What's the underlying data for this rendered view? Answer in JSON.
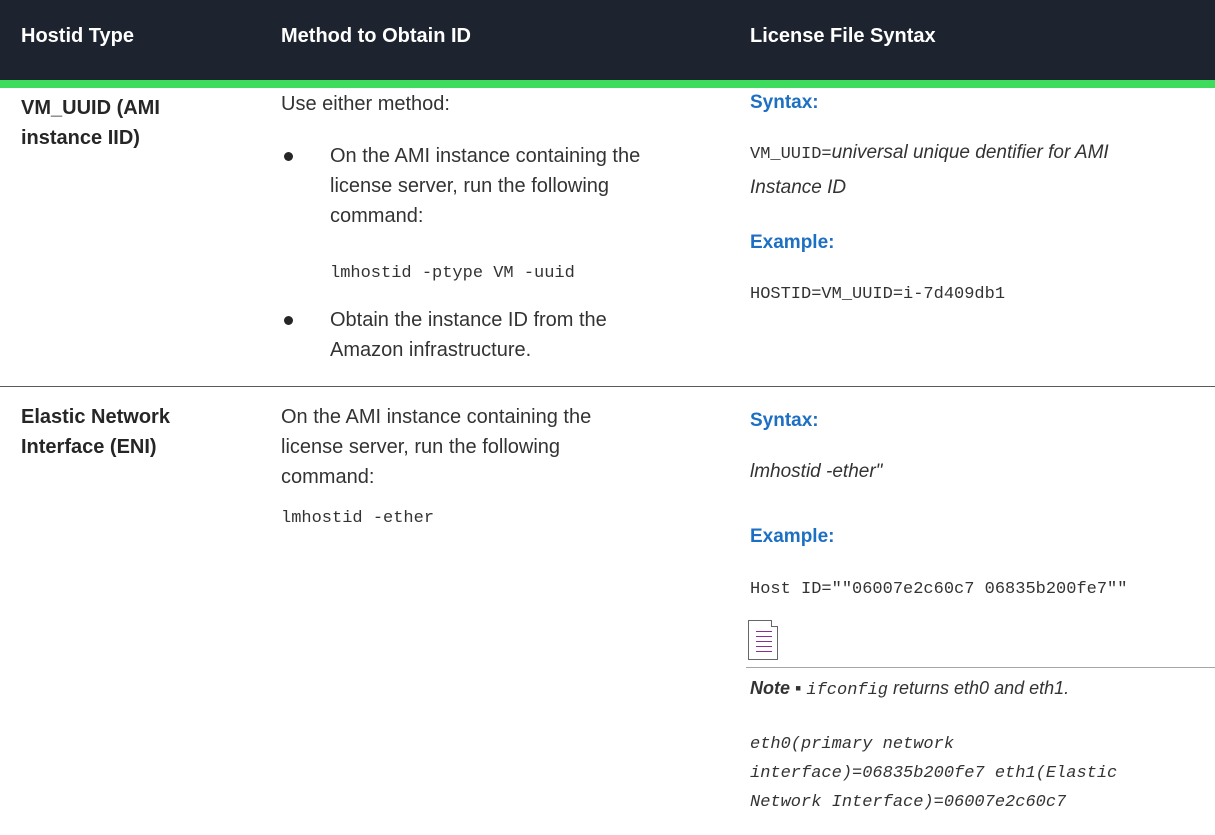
{
  "header": {
    "col1": "Hostid Type",
    "col2": "Method to Obtain ID",
    "col3": "License File Syntax"
  },
  "rows": [
    {
      "hostid_type_line1": "VM_UUID (AMI",
      "hostid_type_line2": "instance IID)",
      "method": {
        "intro": "Use either method:",
        "bullet1_line1": "On the AMI instance containing the",
        "bullet1_line2": "license server, run the following",
        "bullet1_line3": "command:",
        "command": "lmhostid -ptype VM -uuid",
        "bullet2_line1": "Obtain the instance ID from the",
        "bullet2_line2": "Amazon infrastructure."
      },
      "syntax": {
        "syntax_label": "Syntax:",
        "syntax_prefix": "VM_UUID=",
        "syntax_italic_line1": "universal unique dentifier for AMI",
        "syntax_italic_line2": "Instance ID",
        "example_label": "Example:",
        "example_value": "HOSTID=VM_UUID=i-7d409db1"
      }
    },
    {
      "hostid_type_line1": "Elastic Network",
      "hostid_type_line2": "Interface (ENI)",
      "method": {
        "line1": "On the AMI instance containing the",
        "line2": "license server, run the following",
        "line3": "command:",
        "command": "lmhostid -ether"
      },
      "syntax": {
        "syntax_label": "Syntax:",
        "syntax_value": "lmhostid -ether\"",
        "example_label": "Example:",
        "example_value": "Host ID=\"\"06007e2c60c7 06835b200fe7\"\"",
        "note_bold": "Note ▪ ",
        "note_mono": "ifconfig",
        "note_text": " returns eth0 and eth1.",
        "note_line1": "eth0(primary network",
        "note_line2": "interface)=06835b200fe7 eth1(Elastic",
        "note_line3": "Network Interface)=06007e2c60c7"
      }
    }
  ],
  "icons": {
    "note": "note-document-icon"
  },
  "colors": {
    "header_bg": "#1d2430",
    "accent_green": "#3ddc5c",
    "link_blue": "#1d6fc3"
  }
}
